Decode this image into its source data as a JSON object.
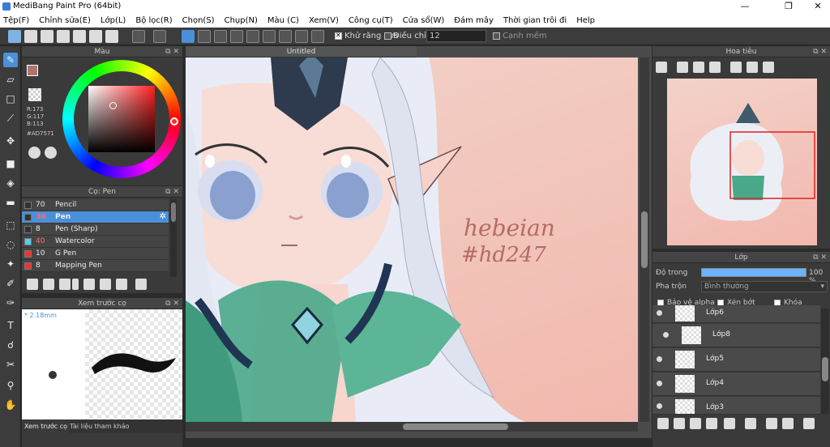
{
  "window": {
    "title": "MediBang Paint Pro (64bit)",
    "minimize": "—",
    "maximize": "❐",
    "close": "✕"
  },
  "menu": [
    "Tệp(F)",
    "Chỉnh sửa(E)",
    "Lớp(L)",
    "Bộ lọc(R)",
    "Chọn(S)",
    "Chụp(N)",
    "Màu (C)",
    "Xem(V)",
    "Công cụ(T)",
    "Cửa sổ(W)",
    "Đám mây",
    "Thời gian trôi đi",
    "Help"
  ],
  "toolbar": {
    "antialias_label": "Khử răng cưa",
    "correction_label": "Điều chỉnh",
    "correction_value": "12",
    "soft_edge_label": "Cạnh mềm"
  },
  "color_panel": {
    "title": "Màu",
    "r": "R:173",
    "g": "G:117",
    "b": "B:113",
    "hex": "#AD7571",
    "fg_color": "#AD7571"
  },
  "brush_panel": {
    "title": "Cọ: Pen",
    "brushes": [
      {
        "size": "70",
        "name": "Pencil",
        "color": "#333333"
      },
      {
        "size": "30",
        "name": "Pen",
        "color": "#333333"
      },
      {
        "size": "8",
        "name": "Pen (Sharp)",
        "color": "#333333"
      },
      {
        "size": "40",
        "name": "Watercolor",
        "color": "#55ccee"
      },
      {
        "size": "10",
        "name": "G Pen",
        "color": "#ee3333"
      },
      {
        "size": "8",
        "name": "Mapping Pen",
        "color": "#ee3333"
      }
    ]
  },
  "preview_panel": {
    "title": "Xem trước cọ",
    "size": "2.18mm",
    "tab_preview": "Xem trước cọ",
    "tab_reference": "Tài liệu tham khảo"
  },
  "canvas": {
    "tab": "Untitled",
    "signature_line1": "hebeian",
    "signature_line2": "#hd247"
  },
  "navigator": {
    "title": "Hoa tiêu"
  },
  "layer_panel": {
    "title": "Lớp",
    "opacity_label": "Độ trong",
    "opacity_value": "100 %",
    "opacity": 1.0,
    "blend_label": "Pha trộn",
    "blend_value": "Bình thường",
    "protect_alpha": "Bảo vệ alpha",
    "clipping": "Xén bớt",
    "lock": "Khóa",
    "layers": [
      {
        "name": "Lớp6"
      },
      {
        "name": "Lớp8"
      },
      {
        "name": "Lớp5"
      },
      {
        "name": "Lớp4"
      },
      {
        "name": "Lớp3"
      }
    ]
  }
}
